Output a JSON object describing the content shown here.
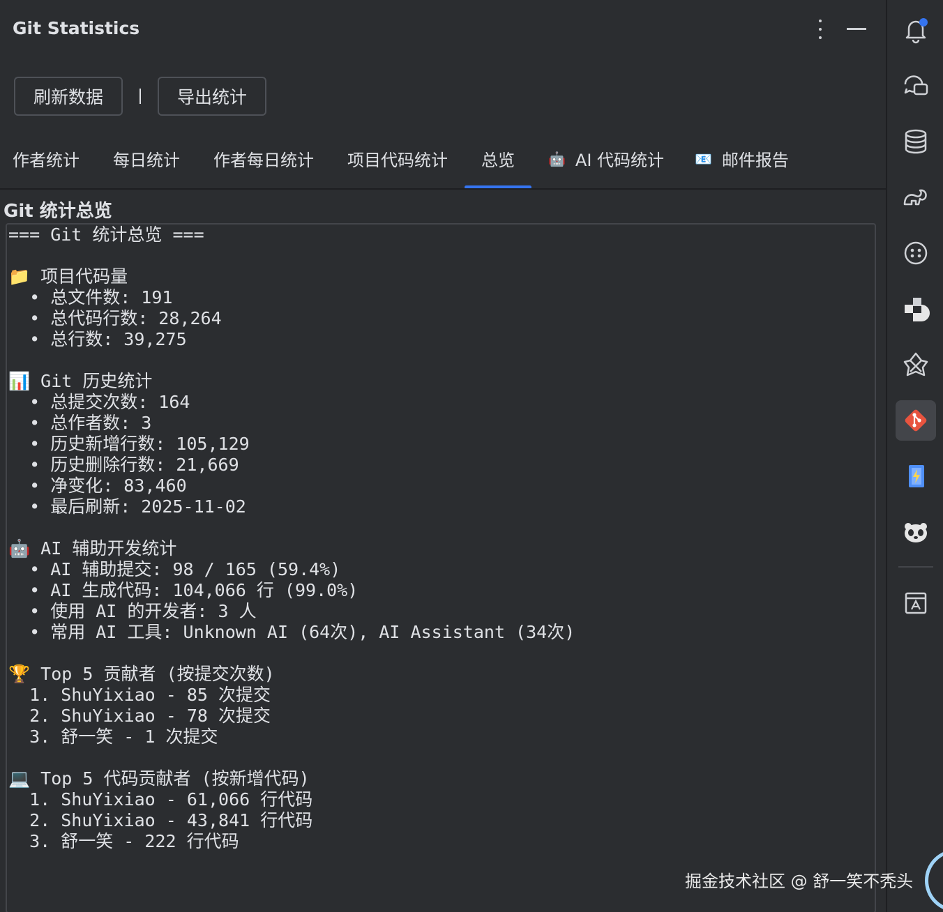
{
  "window": {
    "title": "Git Statistics"
  },
  "toolbar": {
    "refresh_label": "刷新数据",
    "separator": "|",
    "export_label": "导出统计"
  },
  "tabs": [
    {
      "label": "作者统计",
      "icon": ""
    },
    {
      "label": "每日统计",
      "icon": ""
    },
    {
      "label": "作者每日统计",
      "icon": ""
    },
    {
      "label": "项目代码统计",
      "icon": ""
    },
    {
      "label": "总览",
      "icon": ""
    },
    {
      "label": "AI 代码统计",
      "icon": "🤖"
    },
    {
      "label": "邮件报告",
      "icon": "📧"
    }
  ],
  "active_tab": "总览",
  "overview": {
    "section_title": "Git 统计总览",
    "lines": [
      "=== Git 统计总览 ===",
      "",
      "📁 项目代码量",
      "  • 总文件数: 191",
      "  • 总代码行数: 28,264",
      "  • 总行数: 39,275",
      "",
      "📊 Git 历史统计",
      "  • 总提交次数: 164",
      "  • 总作者数: 3",
      "  • 历史新增行数: 105,129",
      "  • 历史删除行数: 21,669",
      "  • 净变化: 83,460",
      "  • 最后刷新: 2025-11-02",
      "",
      "🤖 AI 辅助开发统计",
      "  • AI 辅助提交: 98 / 165 (59.4%)",
      "  • AI 生成代码: 104,066 行 (99.0%)",
      "  • 使用 AI 的开发者: 3 人",
      "  • 常用 AI 工具: Unknown AI (64次), AI Assistant (34次)",
      "",
      "🏆 Top 5 贡献者 (按提交次数)",
      "  1. ShuYixiao - 85 次提交",
      "  2. ShuYixiao - 78 次提交",
      "  3. 舒一笑 - 1 次提交",
      "",
      "💻 Top 5 代码贡献者 (按新增代码)",
      "  1. ShuYixiao - 61,066 行代码",
      "  2. ShuYixiao - 43,841 行代码",
      "  3. 舒一笑 - 222 行代码"
    ]
  },
  "right_toolbar": [
    "notifications-icon",
    "ai-chat-icon",
    "database-icon",
    "gradle-icon",
    "copilot-icon",
    "plugin-icon",
    "ai-assistant-icon",
    "git-statistics-icon",
    "battery-icon",
    "panda-icon",
    "translate-icon"
  ],
  "watermark": "掘金技术社区 @ 舒一笑不秃头",
  "colors": {
    "background": "#2b2d30",
    "text": "#dfe1e5",
    "accent": "#3574f0",
    "git_red": "#e8543f",
    "notification_dot": "#3574f0"
  }
}
